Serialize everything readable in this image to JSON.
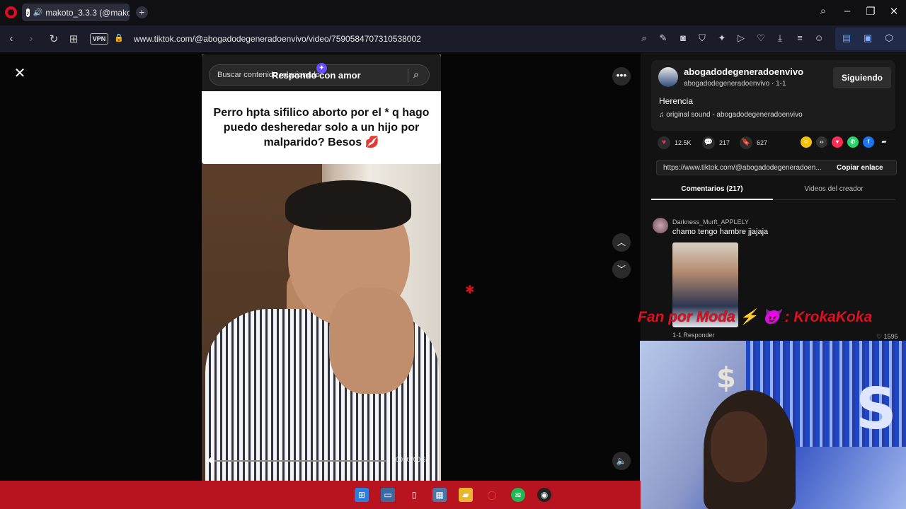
{
  "browser": {
    "tab_title": "makoto_3.3.3 (@mako",
    "url": "www.tiktok.com/@abogadodegeneradoenvivo/video/7590584707310538002",
    "vpn_label": "VPN",
    "accent": "#e00b1c"
  },
  "video": {
    "search_placeholder": "Buscar contenido relacionado",
    "reply_overlay": "Respondo con amor",
    "question": "Perro hpta sifilico aborto por el * q hago puedo desheredar solo a un hijo por malparido? Besos 💋",
    "time": "00:01/00:59",
    "progress_fraction": 0.02
  },
  "panel": {
    "username": "abogadodegeneradoenvivo",
    "subline": "abogadodegeneradoenvivo · 1-1",
    "follow_label": "Siguiendo",
    "description": "Herencia",
    "sound": "original sound - abogadodegeneradoenvivo",
    "likes": "12.5K",
    "comments": "217",
    "saves": "627",
    "copy_url": "https://www.tiktok.com/@abogadodegeneradoen...",
    "copy_label": "Copiar enlace",
    "tab_comments": "Comentarios (217)",
    "tab_videos": "Videos del creador",
    "comment": {
      "author": "Darkness_Murft_APPLELY",
      "text": "chamo tengo hambre jjajaja",
      "meta": "1-1   Responder",
      "likes": "1595"
    }
  },
  "banner": "Fan por Moda ⚡ 😈 : KrokaKoka",
  "icons": [
    "opera-logo",
    "tiktok-favicon",
    "speaker-icon",
    "plus-icon",
    "search-icon",
    "minimize-icon",
    "restore-icon",
    "close-icon",
    "back-icon",
    "forward-icon",
    "reload-icon",
    "speed-dial-icon",
    "lock-icon",
    "close-video-icon",
    "more-icon",
    "chevron-up-icon",
    "chevron-down-icon",
    "volume-icon",
    "heart-icon",
    "comment-icon",
    "bookmark-icon",
    "windows-start-icon",
    "spotify-icon",
    "opera-taskbar-icon"
  ]
}
